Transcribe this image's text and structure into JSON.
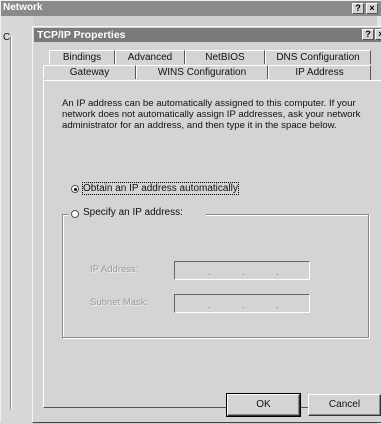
{
  "outer_window": {
    "title": "Network",
    "help_glyph": "?",
    "close_glyph": "×",
    "edge_text": "C"
  },
  "dialog": {
    "title": "TCP/IP Properties",
    "help_glyph": "?",
    "close_glyph": "×",
    "tabs_row1": [
      "Bindings",
      "Advanced",
      "NetBIOS",
      "DNS Configuration"
    ],
    "tabs_row2": [
      "Gateway",
      "WINS Configuration",
      "IP Address"
    ],
    "active_tab": "IP Address",
    "description": "An IP address can be automatically assigned to this computer. If your network does not automatically assign IP addresses, ask your network administrator for an address, and then type it in the space below.",
    "radio_auto_label": "Obtain an IP address automatically",
    "radio_specify_label": "Specify an IP address:",
    "selected_option": "Obtain an IP address automatically",
    "ip_address_label": "IP Address:",
    "subnet_mask_label": "Subnet Mask:",
    "ip_address_value": ". . .",
    "subnet_mask_value": ". . .",
    "ok_label": "OK",
    "cancel_label": "Cancel"
  }
}
